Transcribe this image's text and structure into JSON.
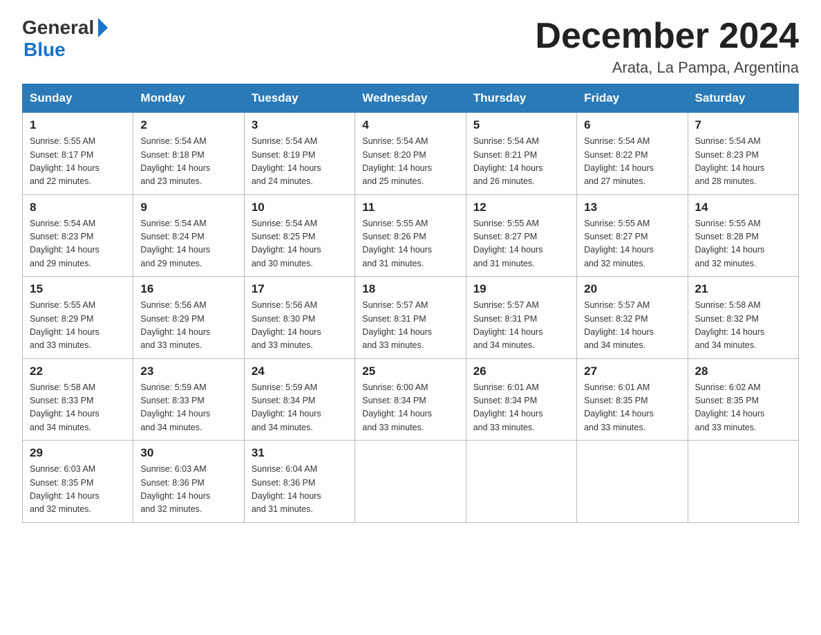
{
  "header": {
    "logo_general": "General",
    "logo_blue": "Blue",
    "month_title": "December 2024",
    "location": "Arata, La Pampa, Argentina"
  },
  "days_of_week": [
    "Sunday",
    "Monday",
    "Tuesday",
    "Wednesday",
    "Thursday",
    "Friday",
    "Saturday"
  ],
  "weeks": [
    [
      {
        "day": "1",
        "sunrise": "5:55 AM",
        "sunset": "8:17 PM",
        "daylight": "14 hours and 22 minutes."
      },
      {
        "day": "2",
        "sunrise": "5:54 AM",
        "sunset": "8:18 PM",
        "daylight": "14 hours and 23 minutes."
      },
      {
        "day": "3",
        "sunrise": "5:54 AM",
        "sunset": "8:19 PM",
        "daylight": "14 hours and 24 minutes."
      },
      {
        "day": "4",
        "sunrise": "5:54 AM",
        "sunset": "8:20 PM",
        "daylight": "14 hours and 25 minutes."
      },
      {
        "day": "5",
        "sunrise": "5:54 AM",
        "sunset": "8:21 PM",
        "daylight": "14 hours and 26 minutes."
      },
      {
        "day": "6",
        "sunrise": "5:54 AM",
        "sunset": "8:22 PM",
        "daylight": "14 hours and 27 minutes."
      },
      {
        "day": "7",
        "sunrise": "5:54 AM",
        "sunset": "8:23 PM",
        "daylight": "14 hours and 28 minutes."
      }
    ],
    [
      {
        "day": "8",
        "sunrise": "5:54 AM",
        "sunset": "8:23 PM",
        "daylight": "14 hours and 29 minutes."
      },
      {
        "day": "9",
        "sunrise": "5:54 AM",
        "sunset": "8:24 PM",
        "daylight": "14 hours and 29 minutes."
      },
      {
        "day": "10",
        "sunrise": "5:54 AM",
        "sunset": "8:25 PM",
        "daylight": "14 hours and 30 minutes."
      },
      {
        "day": "11",
        "sunrise": "5:55 AM",
        "sunset": "8:26 PM",
        "daylight": "14 hours and 31 minutes."
      },
      {
        "day": "12",
        "sunrise": "5:55 AM",
        "sunset": "8:27 PM",
        "daylight": "14 hours and 31 minutes."
      },
      {
        "day": "13",
        "sunrise": "5:55 AM",
        "sunset": "8:27 PM",
        "daylight": "14 hours and 32 minutes."
      },
      {
        "day": "14",
        "sunrise": "5:55 AM",
        "sunset": "8:28 PM",
        "daylight": "14 hours and 32 minutes."
      }
    ],
    [
      {
        "day": "15",
        "sunrise": "5:55 AM",
        "sunset": "8:29 PM",
        "daylight": "14 hours and 33 minutes."
      },
      {
        "day": "16",
        "sunrise": "5:56 AM",
        "sunset": "8:29 PM",
        "daylight": "14 hours and 33 minutes."
      },
      {
        "day": "17",
        "sunrise": "5:56 AM",
        "sunset": "8:30 PM",
        "daylight": "14 hours and 33 minutes."
      },
      {
        "day": "18",
        "sunrise": "5:57 AM",
        "sunset": "8:31 PM",
        "daylight": "14 hours and 33 minutes."
      },
      {
        "day": "19",
        "sunrise": "5:57 AM",
        "sunset": "8:31 PM",
        "daylight": "14 hours and 34 minutes."
      },
      {
        "day": "20",
        "sunrise": "5:57 AM",
        "sunset": "8:32 PM",
        "daylight": "14 hours and 34 minutes."
      },
      {
        "day": "21",
        "sunrise": "5:58 AM",
        "sunset": "8:32 PM",
        "daylight": "14 hours and 34 minutes."
      }
    ],
    [
      {
        "day": "22",
        "sunrise": "5:58 AM",
        "sunset": "8:33 PM",
        "daylight": "14 hours and 34 minutes."
      },
      {
        "day": "23",
        "sunrise": "5:59 AM",
        "sunset": "8:33 PM",
        "daylight": "14 hours and 34 minutes."
      },
      {
        "day": "24",
        "sunrise": "5:59 AM",
        "sunset": "8:34 PM",
        "daylight": "14 hours and 34 minutes."
      },
      {
        "day": "25",
        "sunrise": "6:00 AM",
        "sunset": "8:34 PM",
        "daylight": "14 hours and 33 minutes."
      },
      {
        "day": "26",
        "sunrise": "6:01 AM",
        "sunset": "8:34 PM",
        "daylight": "14 hours and 33 minutes."
      },
      {
        "day": "27",
        "sunrise": "6:01 AM",
        "sunset": "8:35 PM",
        "daylight": "14 hours and 33 minutes."
      },
      {
        "day": "28",
        "sunrise": "6:02 AM",
        "sunset": "8:35 PM",
        "daylight": "14 hours and 33 minutes."
      }
    ],
    [
      {
        "day": "29",
        "sunrise": "6:03 AM",
        "sunset": "8:35 PM",
        "daylight": "14 hours and 32 minutes."
      },
      {
        "day": "30",
        "sunrise": "6:03 AM",
        "sunset": "8:36 PM",
        "daylight": "14 hours and 32 minutes."
      },
      {
        "day": "31",
        "sunrise": "6:04 AM",
        "sunset": "8:36 PM",
        "daylight": "14 hours and 31 minutes."
      },
      null,
      null,
      null,
      null
    ]
  ],
  "labels": {
    "sunrise": "Sunrise:",
    "sunset": "Sunset:",
    "daylight": "Daylight:"
  }
}
